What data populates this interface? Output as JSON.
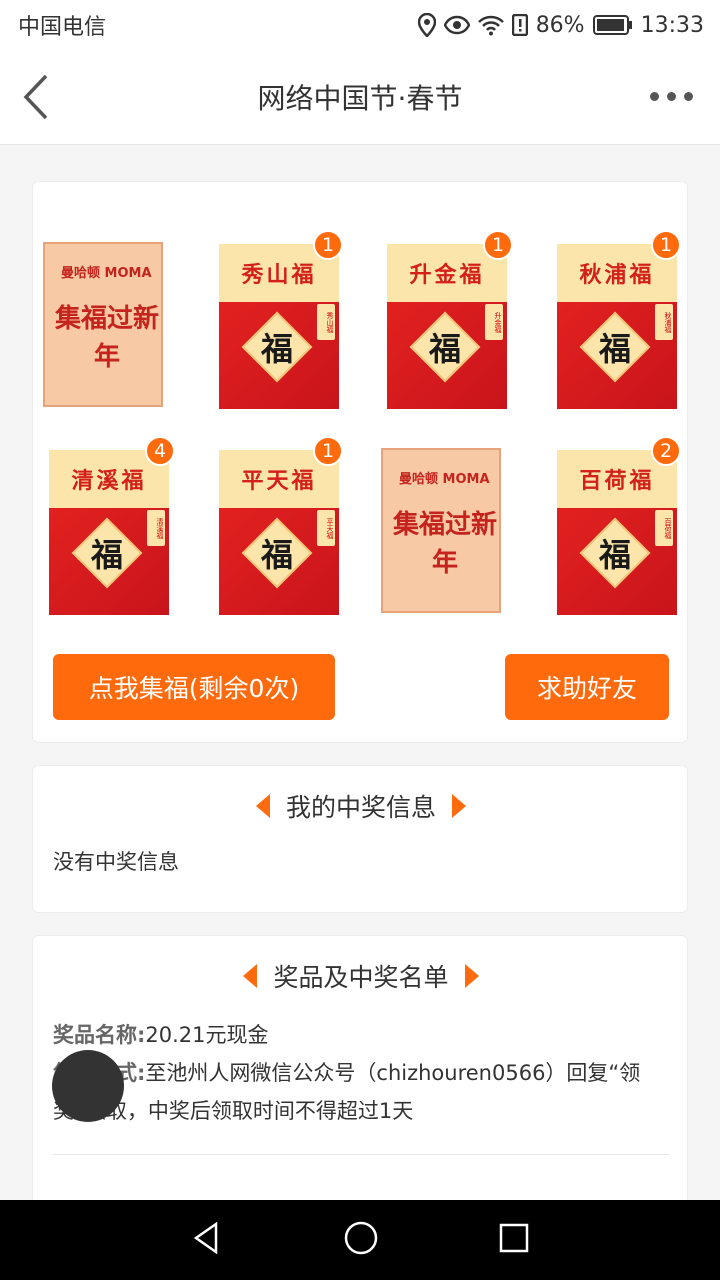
{
  "status": {
    "carrier": "中国电信",
    "battery": "86%",
    "time": "13:33"
  },
  "header": {
    "title": "网络中国节·春节"
  },
  "cards": [
    {
      "type": "blank",
      "logo": "曼哈顿 MOMA",
      "text": "集福过新年",
      "count": null
    },
    {
      "type": "fu",
      "title": "秀山福",
      "char": "福",
      "tag": "秀山福",
      "count": "1"
    },
    {
      "type": "fu",
      "title": "升金福",
      "char": "福",
      "tag": "升金福",
      "count": "1"
    },
    {
      "type": "fu",
      "title": "秋浦福",
      "char": "福",
      "tag": "秋浦福",
      "count": "1"
    },
    {
      "type": "fu",
      "title": "清溪福",
      "char": "福",
      "tag": "清溪福",
      "count": "4"
    },
    {
      "type": "fu",
      "title": "平天福",
      "char": "福",
      "tag": "平天福",
      "count": "1"
    },
    {
      "type": "blank",
      "logo": "曼哈顿 MOMA",
      "text": "集福过新年",
      "count": null
    },
    {
      "type": "fu",
      "title": "百荷福",
      "char": "福",
      "tag": "百荷福",
      "count": "2"
    }
  ],
  "buttons": {
    "collect": "点我集福(剩余0次)",
    "help": "求助好友"
  },
  "my_prize": {
    "heading": "我的中奖信息",
    "empty": "没有中奖信息"
  },
  "prize_list": {
    "heading": "奖品及中奖名单",
    "name_label": "奖品名称:",
    "name_value": "20.21元现金",
    "method_label": "领取方式:",
    "method_value": "至池州人网微信公众号（chizhouren0566）回复“领奖”领取，中奖后领取时间不得超过1天"
  }
}
